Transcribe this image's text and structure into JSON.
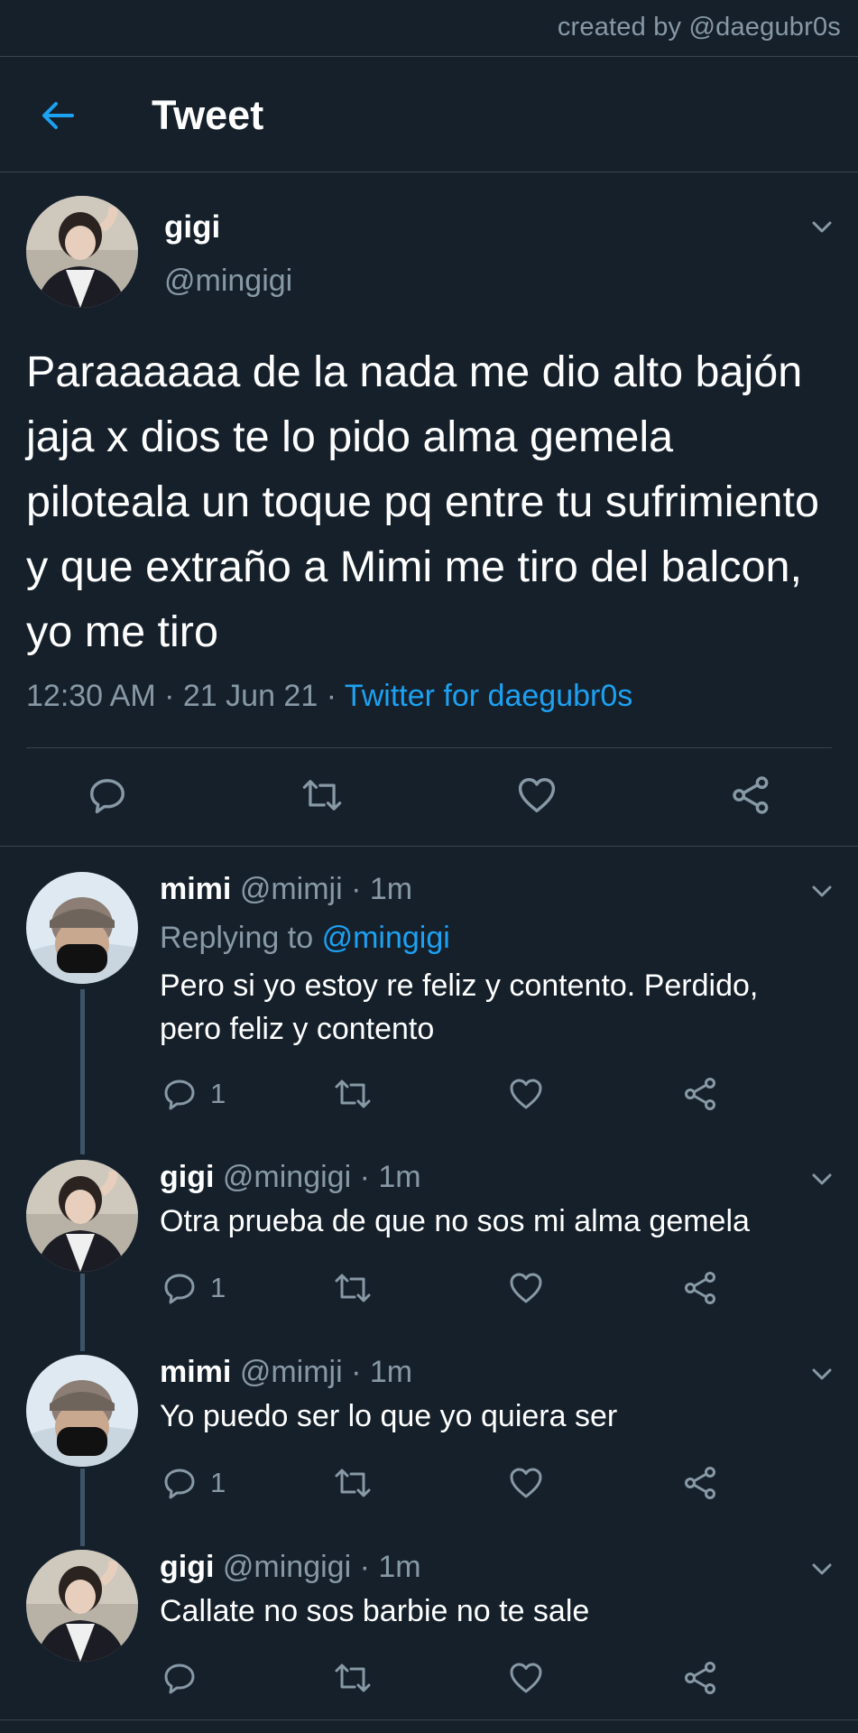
{
  "watermark": "created by @daegubr0s",
  "header": {
    "title": "Tweet"
  },
  "tweet": {
    "name": "gigi",
    "handle": "@mingigi",
    "text": "Paraaaaaa de la nada me dio alto bajón jaja x dios te lo pido alma gemela piloteala un toque pq entre tu sufrimiento y que extraño a Mimi me tiro del balcon, yo me tiro",
    "time": "12:30 AM",
    "date": "21 Jun 21",
    "source": "Twitter for daegubr0s"
  },
  "replies": [
    {
      "name": "mimi",
      "handle": "@mimji",
      "time": "1m",
      "replying_prefix": "Replying to",
      "replying_to": "@mingigi",
      "text": "Pero si yo estoy re feliz y contento. Perdido, pero feliz y contento",
      "reply_count": "1"
    },
    {
      "name": "gigi",
      "handle": "@mingigi",
      "time": "1m",
      "text": "Otra prueba de que no sos mi alma gemela",
      "reply_count": "1"
    },
    {
      "name": "mimi",
      "handle": "@mimji",
      "time": "1m",
      "text": "Yo puedo ser lo que yo quiera ser",
      "reply_count": "1"
    },
    {
      "name": "gigi",
      "handle": "@mingigi",
      "time": "1m",
      "text": "Callate no sos barbie no te sale",
      "reply_count": ""
    }
  ],
  "colors": {
    "background": "#15202b",
    "accent": "#1da1f2",
    "secondary_text": "#8899a6",
    "divider": "#38444d",
    "thread_line": "#3d5466"
  }
}
